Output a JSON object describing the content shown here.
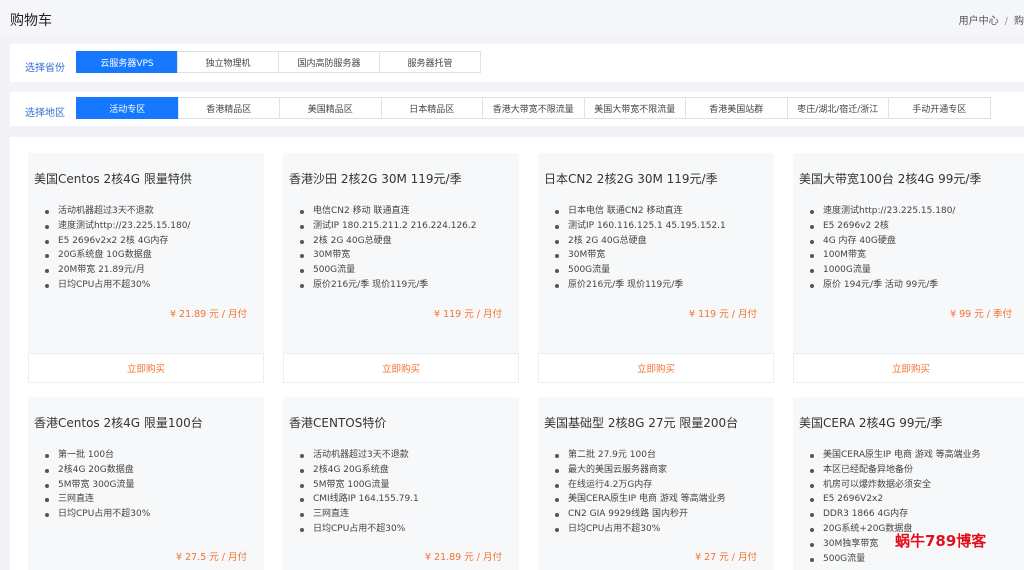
{
  "page": {
    "title": "购物车"
  },
  "breadcrumb": {
    "home": "用户中心",
    "current": "购"
  },
  "filters": {
    "product": {
      "label": "选择省份",
      "options": [
        "云服务器VPS",
        "独立物理机",
        "国内高防服务器",
        "服务器托管"
      ],
      "selected": "云服务器VPS"
    },
    "region": {
      "label": "选择地区",
      "options": [
        "活动专区",
        "香港精品区",
        "美国精品区",
        "日本精品区",
        "香港大带宽不限流量",
        "美国大带宽不限流量",
        "香港美国站群",
        "枣庄/湖北/宿迁/浙江",
        "手动开通专区"
      ],
      "selected": "活动专区"
    }
  },
  "products": [
    {
      "title": "美国Centos 2核4G 限量特供",
      "features": [
        "活动机器超过3天不退款",
        "速度测试http://23.225.15.180/",
        "E5 2696v2x2 2核 4G内存",
        "20G系统盘 10G数据盘",
        "20M带宽 21.89元/月",
        "日均CPU占用不超30%"
      ],
      "price": "¥ 21.89 元 / 月付",
      "buy_label": "立即购买"
    },
    {
      "title": "香港沙田 2核2G 30M 119元/季",
      "features": [
        "电信CN2 移动 联通直连",
        "测试IP 180.215.211.2 216.224.126.2",
        "2核 2G 40G总硬盘",
        "30M带宽",
        "500G流量",
        "原价216元/季 现价119元/季"
      ],
      "price": "¥ 119 元 / 月付",
      "buy_label": "立即购买"
    },
    {
      "title": "日本CN2 2核2G 30M 119元/季",
      "features": [
        "日本电信 联通CN2 移动直连",
        "测试IP 160.116.125.1 45.195.152.1",
        "2核 2G 40G总硬盘",
        "30M带宽",
        "500G流量",
        "原价216元/季 现价119元/季"
      ],
      "price": "¥ 119 元 / 月付",
      "buy_label": "立即购买"
    },
    {
      "title": "美国大带宽100台 2核4G 99元/季",
      "features": [
        "速度测试http://23.225.15.180/",
        "E5 2696v2 2核",
        "4G 内存 40G硬盘",
        "100M带宽",
        "1000G流量",
        "原价 194元/季 活动 99元/季"
      ],
      "price": "¥ 99 元 / 季付",
      "buy_label": "立即购买"
    },
    {
      "title": "香港Centos 2核4G 限量100台",
      "features": [
        "第一批 100台",
        "2核4G 20G数据盘",
        "5M带宽 300G流量",
        "",
        "三网直连",
        "日均CPU占用不超30%"
      ],
      "price": "¥ 27.5 元 / 月付"
    },
    {
      "title": "香港CENTOS特价",
      "features": [
        "活动机器超过3天不退款",
        "2核4G 20G系统盘",
        "5M带宽 100G流量",
        "CMI线路IP 164.155.79.1",
        "三网直连",
        "日均CPU占用不超30%"
      ],
      "price": "¥ 21.89 元 / 月付"
    },
    {
      "title": "美国基础型 2核8G 27元 限量200台",
      "features": [
        "第二批 27.9元 100台",
        "最大的美国云服务器商家",
        "在线运行4.2万G内存",
        "美国CERA原生IP 电商 游戏 等高端业务",
        "CN2 GIA 9929线路 国内秒开",
        "日均CPU占用不超30%"
      ],
      "price": "¥ 27 元 / 月付"
    },
    {
      "title": "美国CERA 2核4G 99元/季",
      "features": [
        "美国CERA原生IP 电商 游戏 等高端业务",
        "本区已经配备异地备份",
        "机房可以爆炸数据必须安全",
        "E5 2696V2x2",
        "DDR3 1866 4G内存",
        "20G系统+20G数据盘",
        "30M独享带宽",
        "500G流量"
      ],
      "price": ""
    }
  ],
  "watermark": "蜗牛789博客"
}
